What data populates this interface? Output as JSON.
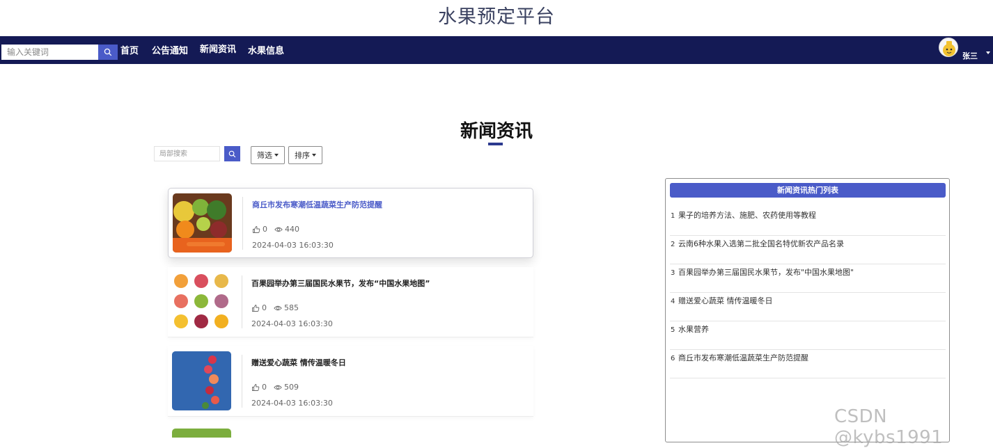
{
  "site": {
    "title": "水果预定平台"
  },
  "nav": {
    "search_placeholder": "输入关键词",
    "items": [
      "首页",
      "公告通知",
      "新闻资讯",
      "水果信息"
    ],
    "user_name": "张三"
  },
  "section": {
    "title": "新闻资讯"
  },
  "toolbar": {
    "search_placeholder": "局部搜索",
    "filter_label": "筛选",
    "sort_label": "排序"
  },
  "news": [
    {
      "title": "商丘市发布寒潮低温蔬菜生产防范提醒",
      "likes": "0",
      "views": "440",
      "date": "2024-04-03 16:03:30"
    },
    {
      "title": "百果园举办第三届国民水果节，发布“中国水果地图”",
      "likes": "0",
      "views": "585",
      "date": "2024-04-03 16:03:30"
    },
    {
      "title": "赠送爱心蔬菜 情传温暖冬日",
      "likes": "0",
      "views": "509",
      "date": "2024-04-03 16:03:30"
    }
  ],
  "hot": {
    "title": "新闻资讯热门列表",
    "items": [
      {
        "num": "1",
        "text": "果子的培养方法、施肥、农药使用等教程"
      },
      {
        "num": "2",
        "text": "云南6种水果入选第二批全国名特优新农产品名录"
      },
      {
        "num": "3",
        "text": "百果园举办第三届国民水果节，发布\"中国水果地图\""
      },
      {
        "num": "4",
        "text": "赠送爱心蔬菜 情传温暖冬日"
      },
      {
        "num": "5",
        "text": "水果营养"
      },
      {
        "num": "6",
        "text": "商丘市发布寒潮低温蔬菜生产防范提醒"
      }
    ]
  },
  "watermark": "CSDN @kybs1991",
  "colors": {
    "navbar": "#141a55",
    "accent": "#4a5bc8"
  }
}
